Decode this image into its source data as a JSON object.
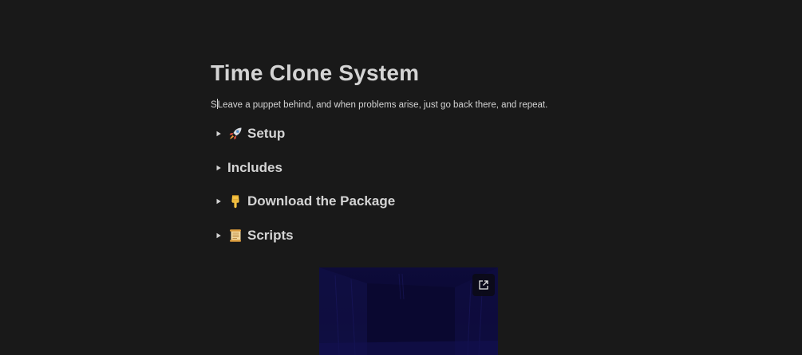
{
  "page": {
    "title": "Time Clone System",
    "description_prefix": "S",
    "description": "Leave a puppet behind, and when problems arise, just go back there, and repeat."
  },
  "toggles": [
    {
      "icon": "rocket-icon",
      "label": "Setup"
    },
    {
      "icon": "",
      "label": "Includes"
    },
    {
      "icon": "pointing-down-icon",
      "label": "Download the Package"
    },
    {
      "icon": "scroll-icon",
      "label": "Scripts"
    }
  ],
  "media": {
    "open_icon": "external-link-icon"
  },
  "colors": {
    "background": "#191919",
    "text": "#d4d4d4",
    "media_bg": "#0d0b3a"
  }
}
